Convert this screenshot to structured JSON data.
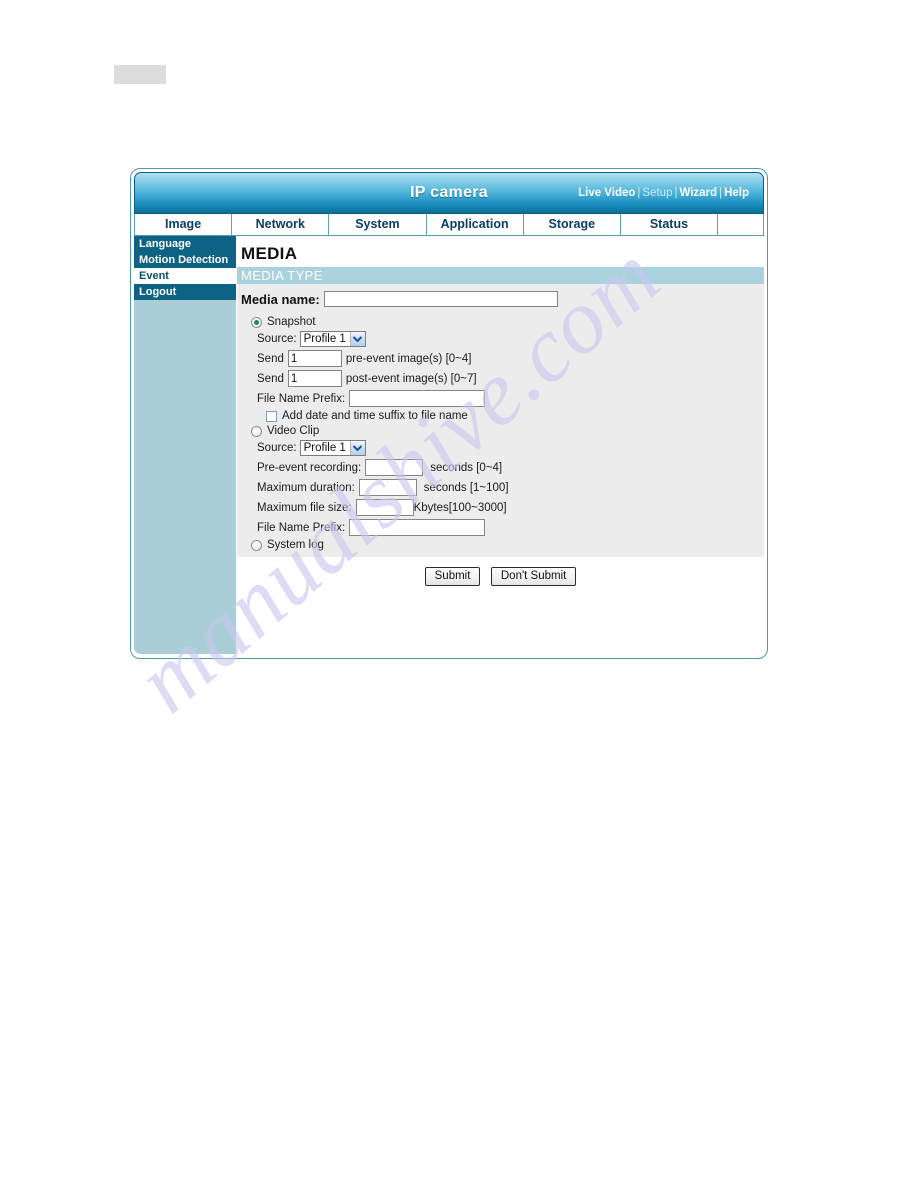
{
  "watermark": {
    "text": "manualshive.com"
  },
  "header": {
    "title": "IP camera",
    "links": [
      {
        "label": "Live Video",
        "dim": false
      },
      {
        "label": "Setup",
        "dim": true
      },
      {
        "label": "Wizard",
        "dim": false
      },
      {
        "label": "Help",
        "dim": false
      }
    ],
    "separator": "|"
  },
  "tabs": [
    {
      "label": "Image"
    },
    {
      "label": "Network"
    },
    {
      "label": "System"
    },
    {
      "label": "Application"
    },
    {
      "label": "Storage"
    },
    {
      "label": "Status"
    }
  ],
  "sidebar": {
    "items": [
      {
        "label": "Language",
        "active": false
      },
      {
        "label": "Motion Detection",
        "active": false
      },
      {
        "label": "Event",
        "active": true
      },
      {
        "label": "Logout",
        "active": false
      }
    ]
  },
  "main": {
    "page_title": "MEDIA",
    "section_title": "MEDIA TYPE",
    "media_name": {
      "label": "Media name:",
      "value": "",
      "placeholder": ""
    },
    "snapshot": {
      "label": "Snapshot",
      "selected": true,
      "source_label": "Source:",
      "source_value": "Profile 1",
      "source_options": [
        "Profile 1"
      ],
      "pre_event": {
        "prefix_label": "Send",
        "value": "1",
        "suffix_label": "pre-event image(s) [0~4]"
      },
      "post_event": {
        "prefix_label": "Send",
        "value": "1",
        "suffix_label": "post-event image(s) [0~7]"
      },
      "file_name_prefix": {
        "label": "File Name Prefix:",
        "value": ""
      },
      "add_suffix": {
        "label": "Add date and time suffix to file name",
        "checked": false
      }
    },
    "video_clip": {
      "label": "Video Clip",
      "selected": false,
      "source_label": "Source:",
      "source_value": "Profile 1",
      "source_options": [
        "Profile 1"
      ],
      "pre_event_recording": {
        "label": "Pre-event recording:",
        "value": "",
        "suffix": "seconds [0~4]"
      },
      "maximum_duration": {
        "label": "Maximum duration:",
        "value": "",
        "suffix": "seconds [1~100]"
      },
      "maximum_file_size": {
        "label": "Maximum file size:",
        "value": "",
        "suffix": "Kbytes[100~3000]"
      },
      "file_name_prefix": {
        "label": "File Name Prefix:",
        "value": ""
      }
    },
    "system_log": {
      "label": "System log",
      "selected": false
    },
    "buttons": {
      "submit": "Submit",
      "dont_submit": "Don't Submit"
    }
  },
  "colors": {
    "header_gradient_top": "#b4e1f2",
    "header_gradient_bottom": "#0a6f96",
    "sidebar_item": "#0e6283",
    "sidebar_bg": "#a9ced8",
    "section_bar": "#a9d2de",
    "form_bg": "#ececec",
    "radio_dot": "#1f8a4c",
    "watermark": "#c9c8ee"
  }
}
